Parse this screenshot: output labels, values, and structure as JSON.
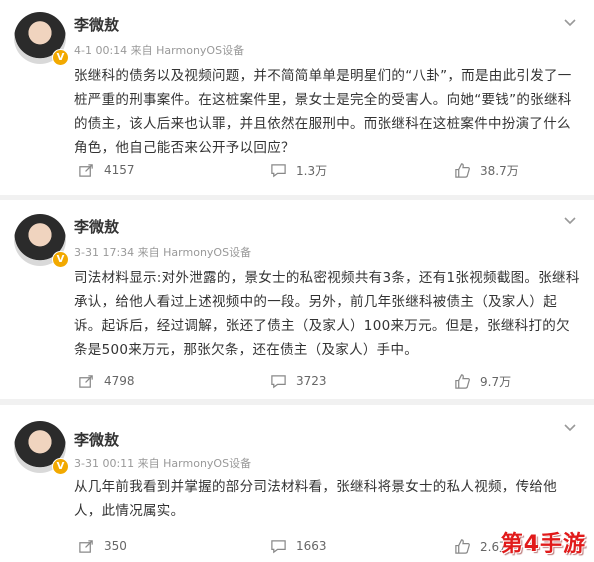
{
  "posts": [
    {
      "author": "李微敖",
      "meta": "4-1 00:14  来自 HarmonyOS设备",
      "text": "张继科的债务以及视频问题，并不简简单单是明星们的“八卦”，而是由此引发了一桩严重的刑事案件。在这桩案件里，景女士是完全的受害人。向她“要钱”的张继科的债主，该人后来也认罪，并且依然在服刑中。而张继科在这桩案件中扮演了什么角色，他自己能否来公开予以回应？",
      "reposts": "4157",
      "comments": "1.3万",
      "likes": "38.7万"
    },
    {
      "author": "李微敖",
      "meta": "3-31 17:34  来自 HarmonyOS设备",
      "text": "司法材料显示:对外泄露的，景女士的私密视频共有3条，还有1张视频截图。张继科承认，给他人看过上述视频中的一段。另外，前几年张继科被债主（及家人）起诉。起诉后，经过调解，张还了债主（及家人）100来万元。但是，张继科打的欠条是500来万元，那张欠条，还在债主（及家人）手中。",
      "reposts": "4798",
      "comments": "3723",
      "likes": "9.7万"
    },
    {
      "author": "李微敖",
      "meta": "3-31 00:11  来自 HarmonyOS设备",
      "text": "从几年前我看到并掌握的部分司法材料看，张继科将景女士的私人视频，传给他人，此情况属实。",
      "reposts": "350",
      "comments": "1663",
      "likes": "2.6万"
    }
  ],
  "watermark": "第4手游",
  "colors": {
    "verified_badge": "#f2a900",
    "watermark": "#e11a1a"
  },
  "icons": {
    "repost": "repost-icon",
    "comment": "comment-icon",
    "like": "like-icon",
    "menu": "chevron-down-icon",
    "verified": "verified-badge-icon"
  }
}
